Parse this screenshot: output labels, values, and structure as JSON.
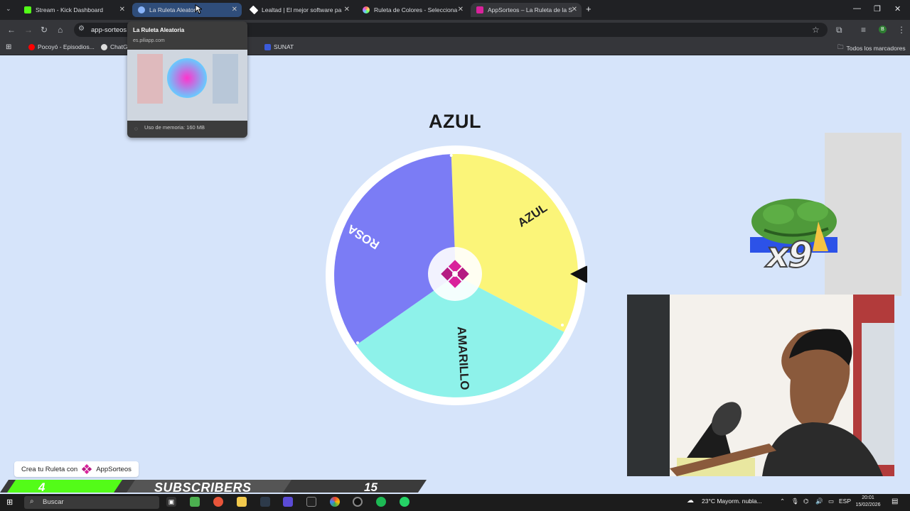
{
  "browser": {
    "tabs": [
      {
        "title": "Stream - Kick Dashboard",
        "color": "#53fc18"
      },
      {
        "title": "La Ruleta Aleatoria",
        "color": "#8ab4f8"
      },
      {
        "title": "Lealtad | El mejor software pa",
        "color": "#ffffff"
      },
      {
        "title": "Ruleta de Colores - Selecciona",
        "color": "#c58af9"
      },
      {
        "title": "AppSorteos – La Ruleta de la S",
        "color": "#d9229b"
      }
    ],
    "new_tab": "+",
    "address": "app-sorteos",
    "bookmarks": [
      {
        "label": "Pocoyó - Episodios...",
        "color": "#ff0000"
      },
      {
        "label": "ChatGPT",
        "color": "#dddddd"
      },
      {
        "label": "SUNAT",
        "color": "#3b5bdb"
      }
    ],
    "all_bookmarks": "Todos los marcadores"
  },
  "tab_preview": {
    "title": "La Ruleta Aleatoria",
    "url": "es.piliapp.com",
    "memory": "Uso de memoria: 160 MB"
  },
  "roulette": {
    "result": "AZUL",
    "segments": [
      {
        "label": "AZUL",
        "color": "#fbf579"
      },
      {
        "label": "AMARILLO",
        "color": "#8ef2ea"
      },
      {
        "label": "ROSA",
        "color": "#7b7cf5"
      }
    ],
    "accent": "#d9229b"
  },
  "overlay": {
    "multiplier": "x9",
    "subscribers_count": "4",
    "subscribers_label": "SUBSCRIBERS",
    "subscribers_goal": "15",
    "promo_text": "Crea tu Ruleta con",
    "promo_brand": "AppSorteos"
  },
  "taskbar": {
    "search": "Buscar",
    "weather": "23°C  Mayorm. nubla...",
    "lang": "ESP",
    "time": "20:01",
    "date": "15/02/2026"
  }
}
